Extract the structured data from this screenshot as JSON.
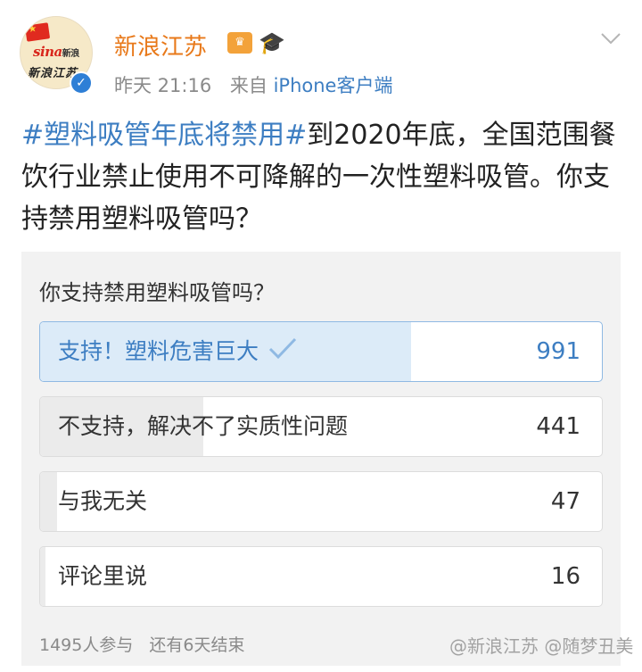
{
  "post": {
    "username": "新浪江苏",
    "time": "昨天 21:16",
    "source_prefix": "来自",
    "source": "iPhone客户端",
    "hashtag": "#塑料吸管年底将禁用#",
    "body": "到2020年底，全国范围餐饮行业禁止使用不可降解的一次性塑料吸管。你支持禁用塑料吸管吗？",
    "icons": [
      "sina-avatar",
      "verified-icon",
      "crown-badge-icon",
      "graduation-cap-icon",
      "chevron-down-icon"
    ],
    "avatar_text": "sina新浪 新浪江苏"
  },
  "poll": {
    "question": "你支持禁用塑料吸管吗？",
    "options": [
      {
        "label": "支持！塑料危害巨大",
        "count": "991",
        "selected": true,
        "fill_fraction": 0.66
      },
      {
        "label": "不支持，解决不了实质性问题",
        "count": "441",
        "selected": false,
        "fill_fraction": 0.29
      },
      {
        "label": "与我无关",
        "count": "47",
        "selected": false,
        "fill_fraction": 0.03
      },
      {
        "label": "评论里说",
        "count": "16",
        "selected": false,
        "fill_fraction": 0.01
      }
    ],
    "participants": "1495人参与",
    "remaining": "还有6天结束"
  },
  "watermark": "@新浪江苏 @随梦丑美",
  "colors": {
    "username": "#e8791a",
    "link": "#3d7ec2",
    "selected_fill": "#dcebf8",
    "poll_bg": "#f2f2f2"
  }
}
